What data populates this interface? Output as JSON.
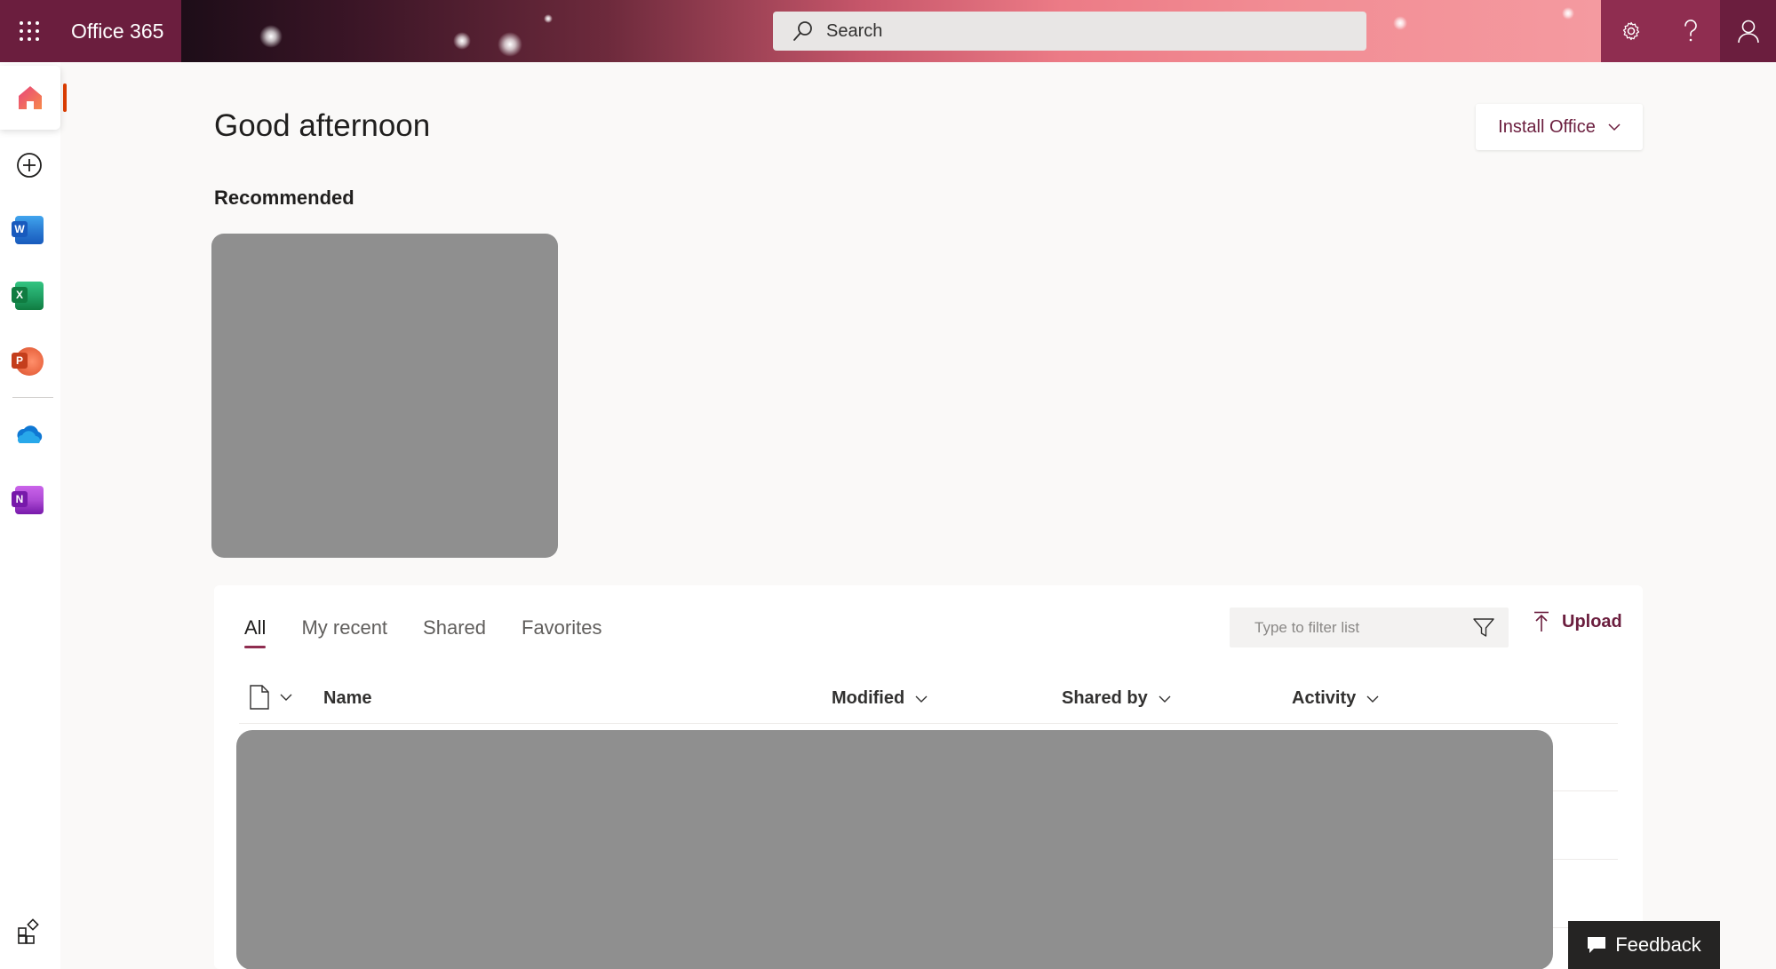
{
  "app": {
    "title": "Office 365",
    "accent": "#6b1e3e"
  },
  "search": {
    "placeholder": "Search"
  },
  "header_icons": [
    "waffle-icon",
    "gear-icon",
    "help-icon",
    "person-icon"
  ],
  "rail": {
    "items": [
      "home-icon",
      "create-icon",
      "word-icon",
      "excel-icon",
      "powerpoint-icon",
      "onedrive-icon",
      "onenote-icon",
      "apps-icon"
    ]
  },
  "main": {
    "greeting": "Good afternoon",
    "install_label": "Install Office",
    "recommended_label": "Recommended"
  },
  "files": {
    "tabs": [
      {
        "label": "All",
        "active": true
      },
      {
        "label": "My recent",
        "active": false
      },
      {
        "label": "Shared",
        "active": false
      },
      {
        "label": "Favorites",
        "active": false
      }
    ],
    "filter_placeholder": "Type to filter list",
    "upload_label": "Upload",
    "columns": [
      "Name",
      "Modified",
      "Shared by",
      "Activity"
    ]
  },
  "feedback_label": "Feedback"
}
